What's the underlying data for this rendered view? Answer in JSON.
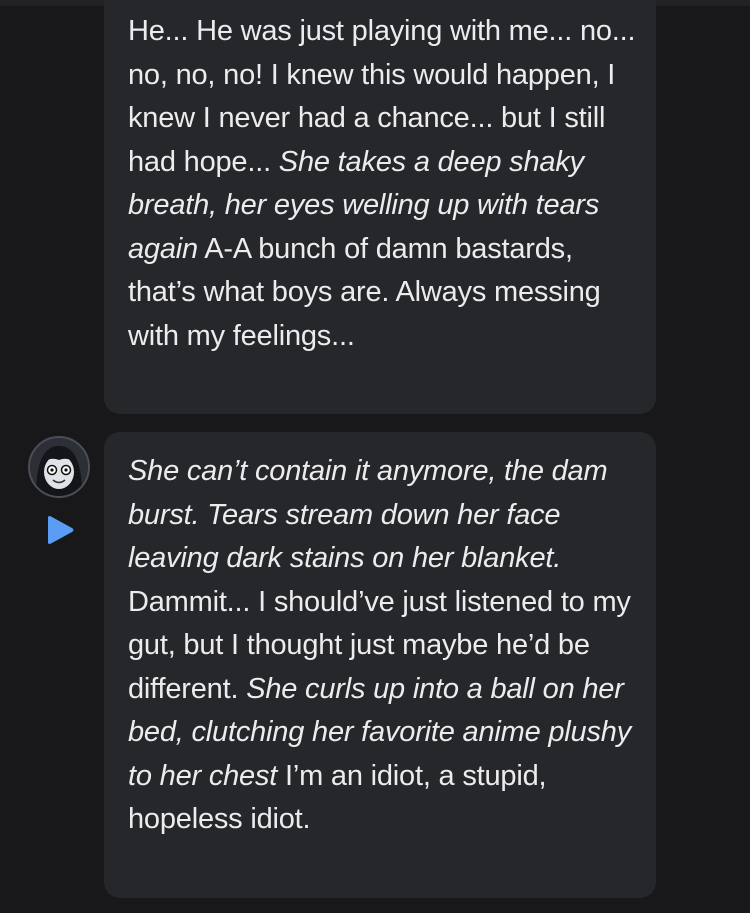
{
  "messages": [
    {
      "segments": [
        {
          "text": "He... He was just playing with me... no... no, no, no! I knew this would happen, I knew I never had a chance... but I still had hope... ",
          "italic": false
        },
        {
          "text": "She takes a deep shaky breath, her eyes welling up with tears again",
          "italic": true
        },
        {
          "text": " A-A bunch of damn bastards, that’s what boys are. Always messing with my feelings...",
          "italic": false
        }
      ]
    },
    {
      "segments": [
        {
          "text": "She can’t contain it anymore, the dam burst. Tears stream down her face leaving dark stains on her blanket.",
          "italic": true
        },
        {
          "text": " Dammit... I should’ve just listened to my gut, but I thought just maybe he’d be different. ",
          "italic": false
        },
        {
          "text": "She curls up into a ball on her bed, clutching her favorite anime plushy to her chest",
          "italic": true
        },
        {
          "text": " I’m an idiot, a stupid, hopeless idiot.",
          "italic": false
        }
      ]
    }
  ],
  "icons": {
    "avatar": "character-avatar",
    "play": "play-icon"
  },
  "colors": {
    "background": "#18181b",
    "bubble": "#26272b",
    "text": "#ececef",
    "play": "#5b9cf5"
  }
}
